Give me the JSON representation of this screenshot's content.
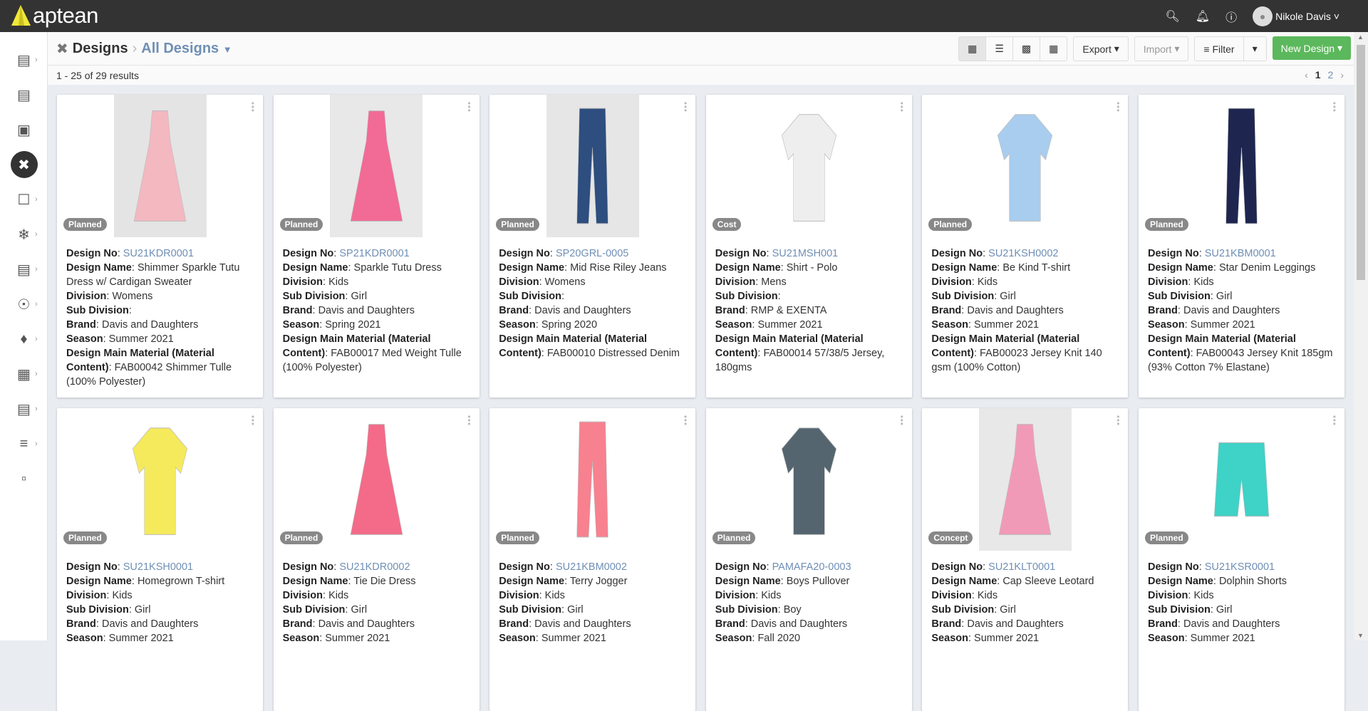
{
  "app": {
    "logo": "aptean",
    "user": "Nikole Davis"
  },
  "breadcrumb": {
    "root": "Designs",
    "current": "All Designs"
  },
  "toolbar": {
    "export": "Export",
    "import": "Import",
    "filter": "Filter",
    "new_design": "New Design"
  },
  "results": {
    "summary": "1 - 25 of 29 results",
    "pages": [
      "1",
      "2"
    ]
  },
  "labels": {
    "no": "Design No",
    "name": "Design Name",
    "division": "Division",
    "subdivision": "Sub Division",
    "brand": "Brand",
    "season": "Season",
    "material": "Design Main Material (Material Content)"
  },
  "cards": [
    {
      "status": "Planned",
      "no": "SU21KDR0001",
      "name": "Shimmer Sparkle Tutu Dress w/ Cardigan Sweater",
      "division": "Womens",
      "subdivision": "",
      "brand": "Davis and Daughters",
      "season": "Summer 2021",
      "material": "FAB00042 Shimmer Tulle (100% Polyester)",
      "color": "#f3b8c0",
      "bg": "#e4e4e4",
      "shape": "dress"
    },
    {
      "status": "Planned",
      "no": "SP21KDR0001",
      "name": "Sparkle Tutu Dress",
      "division": "Kids",
      "subdivision": "Girl",
      "brand": "Davis and Daughters",
      "season": "Spring 2021",
      "material": "FAB00017 Med Weight Tulle (100% Polyester)",
      "color": "#f26a96",
      "bg": "#e8e8e8",
      "shape": "dress"
    },
    {
      "status": "Planned",
      "no": "SP20GRL-0005",
      "name": "Mid Rise Riley Jeans",
      "division": "Womens",
      "subdivision": "",
      "brand": "Davis and Daughters",
      "season": "Spring 2020",
      "material": "FAB00010 Distressed Denim",
      "color": "#2d4e7e",
      "bg": "#e6e6e6",
      "shape": "pants"
    },
    {
      "status": "Cost",
      "no": "SU21MSH001",
      "name": "Shirt - Polo",
      "division": "Mens",
      "subdivision": "",
      "brand": "RMP & EXENTA",
      "season": "Summer 2021",
      "material": "FAB00014 57/38/5 Jersey, 180gms",
      "color": "#eeeeee",
      "bg": "#ffffff",
      "shape": "shirt"
    },
    {
      "status": "Planned",
      "no": "SU21KSH0002",
      "name": "Be Kind T-shirt",
      "division": "Kids",
      "subdivision": "Girl",
      "brand": "Davis and Daughters",
      "season": "Summer 2021",
      "material": "FAB00023 Jersey Knit 140 gsm (100% Cotton)",
      "color": "#a9cdee",
      "bg": "#ffffff",
      "shape": "shirt"
    },
    {
      "status": "Planned",
      "no": "SU21KBM0001",
      "name": "Star Denim Leggings",
      "division": "Kids",
      "subdivision": "Girl",
      "brand": "Davis and Daughters",
      "season": "Summer 2021",
      "material": "FAB00043 Jersey Knit 185gm (93% Cotton 7% Elastane)",
      "color": "#1e2650",
      "bg": "#ffffff",
      "shape": "pants"
    },
    {
      "status": "Planned",
      "no": "SU21KSH0001",
      "name": "Homegrown T-shirt",
      "division": "Kids",
      "subdivision": "Girl",
      "brand": "Davis and Daughters",
      "season": "Summer 2021",
      "material": "",
      "color": "#f5ea5c",
      "bg": "#ffffff",
      "shape": "shirt"
    },
    {
      "status": "Planned",
      "no": "SU21KDR0002",
      "name": "Tie Die Dress",
      "division": "Kids",
      "subdivision": "Girl",
      "brand": "Davis and Daughters",
      "season": "Summer 2021",
      "material": "",
      "color": "#f36b88",
      "bg": "#ffffff",
      "shape": "dress"
    },
    {
      "status": "Planned",
      "no": "SU21KBM0002",
      "name": "Terry Jogger",
      "division": "Kids",
      "subdivision": "Girl",
      "brand": "Davis and Daughters",
      "season": "Summer 2021",
      "material": "",
      "color": "#f7818f",
      "bg": "#ffffff",
      "shape": "pants"
    },
    {
      "status": "Planned",
      "no": "PAMAFA20-0003",
      "name": "Boys Pullover",
      "division": "Kids",
      "subdivision": "Boy",
      "brand": "Davis and Daughters",
      "season": "Fall 2020",
      "material": "",
      "color": "#556570",
      "bg": "#ffffff",
      "shape": "shirt"
    },
    {
      "status": "Concept",
      "no": "SU21KLT0001",
      "name": "Cap Sleeve Leotard",
      "division": "Kids",
      "subdivision": "Girl",
      "brand": "Davis and Daughters",
      "season": "Summer 2021",
      "material": "",
      "color": "#f19ab8",
      "bg": "#e8e8e8",
      "shape": "dress"
    },
    {
      "status": "Planned",
      "no": "SU21KSR0001",
      "name": "Dolphin Shorts",
      "division": "Kids",
      "subdivision": "Girl",
      "brand": "Davis and Daughters",
      "season": "Summer 2021",
      "material": "",
      "color": "#3fd2c7",
      "bg": "#ffffff",
      "shape": "shorts"
    }
  ]
}
